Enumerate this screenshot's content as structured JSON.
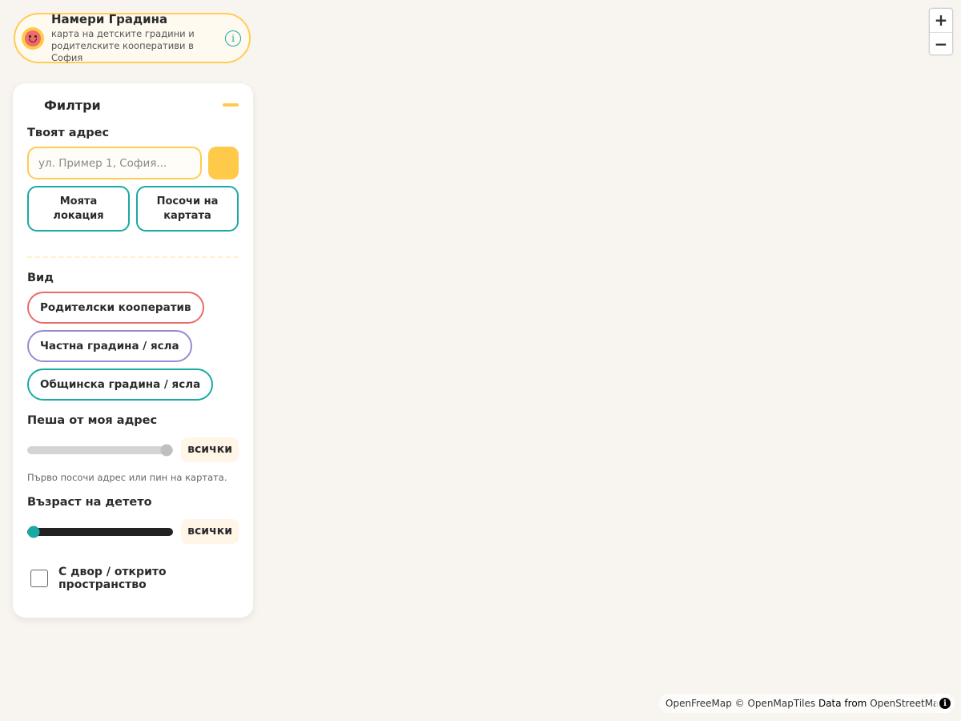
{
  "brand": {
    "title": "Намери Градина",
    "subtitle": "карта на детските градини и родителските кооперативи в София",
    "info_icon": "info-circle-icon"
  },
  "filters": {
    "title": "Филтри",
    "address": {
      "label": "Твоят адрес",
      "placeholder": "ул. Пример 1, София...",
      "value": "",
      "my_location_label": "Моята локация",
      "pick_on_map_label": "Посочи на картата"
    },
    "kind": {
      "label": "Вид",
      "options": [
        {
          "label": "Родителски кооператив",
          "color": "#e96b6b"
        },
        {
          "label": "Частна градина / ясла",
          "color": "#9b88d6"
        },
        {
          "label": "Общинска градина / ясла",
          "color": "#1aa9a3"
        }
      ]
    },
    "walk": {
      "label": "Пеша от моя адрес",
      "value_label": "всички",
      "slider_fraction": 1.0,
      "hint": "Първо посочи адрес или пин на картата."
    },
    "age": {
      "label": "Възраст на детето",
      "value_label": "всички",
      "slider_fraction": 0.0
    },
    "yard": {
      "label": "С двор / открито пространство",
      "checked": false
    }
  },
  "map_controls": {
    "zoom_in": "+",
    "zoom_out": "−"
  },
  "attribution": {
    "openfreemap": "OpenFreeMap",
    "openmaptiles": "© OpenMapTiles",
    "data_from": "Data from",
    "osm": "OpenStreetMap",
    "icon": "i"
  },
  "colors": {
    "accent_yellow": "#ffc94a",
    "accent_teal": "#1aa9a3",
    "coop_red": "#e96b6b",
    "private_purple": "#9b88d6",
    "map_background": "#f8f5f0"
  }
}
